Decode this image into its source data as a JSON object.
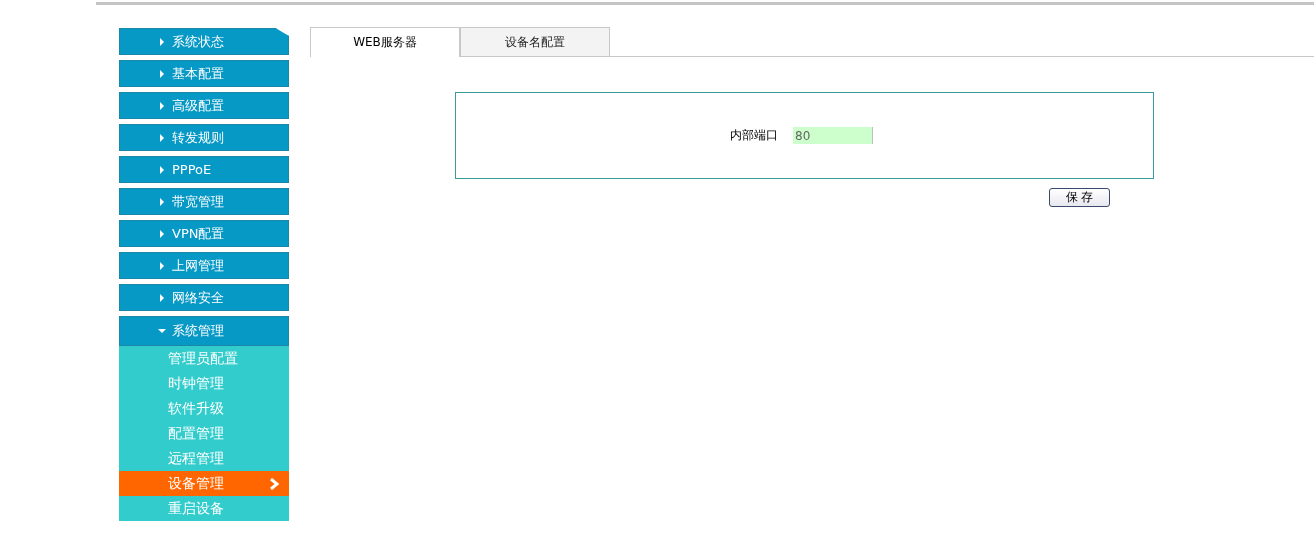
{
  "sidebar": {
    "items": [
      {
        "label": "系统状态",
        "expanded": false
      },
      {
        "label": "基本配置",
        "expanded": false
      },
      {
        "label": "高级配置",
        "expanded": false
      },
      {
        "label": "转发规则",
        "expanded": false
      },
      {
        "label": "PPPoE",
        "expanded": false
      },
      {
        "label": "带宽管理",
        "expanded": false
      },
      {
        "label": "VPN配置",
        "expanded": false
      },
      {
        "label": "上网管理",
        "expanded": false
      },
      {
        "label": "网络安全",
        "expanded": false
      },
      {
        "label": "系统管理",
        "expanded": true,
        "children": [
          {
            "label": "管理员配置",
            "selected": false
          },
          {
            "label": "时钟管理",
            "selected": false
          },
          {
            "label": "软件升级",
            "selected": false
          },
          {
            "label": "配置管理",
            "selected": false
          },
          {
            "label": "远程管理",
            "selected": false
          },
          {
            "label": "设备管理",
            "selected": true
          },
          {
            "label": "重启设备",
            "selected": false
          }
        ]
      }
    ]
  },
  "tabs": [
    {
      "label": "WEB服务器",
      "selected": true
    },
    {
      "label": "设备名配置",
      "selected": false
    }
  ],
  "form": {
    "fields": [
      {
        "label": "内部端口",
        "value": "80"
      }
    ]
  },
  "buttons": [
    "保 存"
  ]
}
